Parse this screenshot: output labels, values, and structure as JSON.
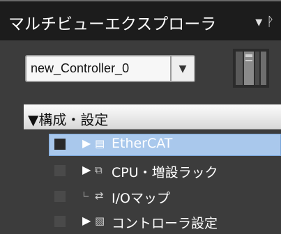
{
  "panel": {
    "title": "マルチビューエクスプローラ",
    "dropdown_icon": "chevron-down-icon",
    "pin_icon": "pin-icon"
  },
  "controller_select": {
    "value": "new_Controller_0",
    "arrow_icon": "chevron-down-icon"
  },
  "device_icon": "controller-device-icon",
  "tree": {
    "header_label": "▼構成・設定",
    "items": [
      {
        "label": "EtherCAT",
        "icon": "ethercat-icon",
        "selected": true
      },
      {
        "label": "CPU・増設ラック",
        "icon": "cpu-rack-icon",
        "selected": false
      },
      {
        "label": "I/Oマップ",
        "icon": "io-map-icon",
        "selected": false
      },
      {
        "label": "コントローラ設定",
        "icon": "controller-settings-icon",
        "selected": false
      }
    ]
  },
  "colors": {
    "titlebar_bg": "#1c1c1c",
    "panel_bg": "#3c3c3c",
    "selection_bg": "#a9c8ec"
  }
}
